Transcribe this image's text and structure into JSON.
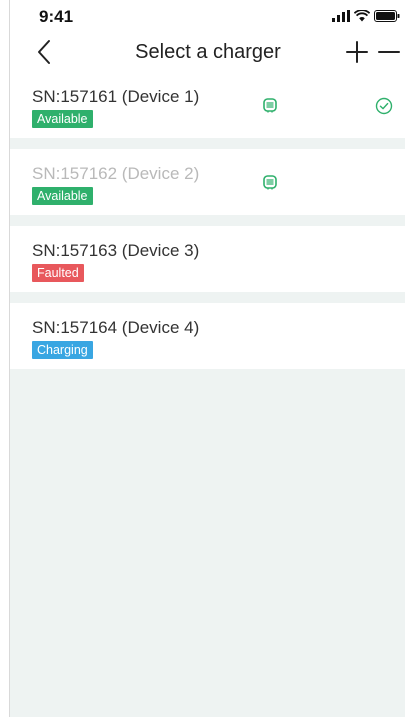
{
  "status_bar": {
    "time": "9:41"
  },
  "nav": {
    "title": "Select a charger"
  },
  "colors": {
    "available": "#2fb06c",
    "faulted": "#e8585c",
    "charging": "#39a6e2",
    "accent": "#2fb06c"
  },
  "chargers": [
    {
      "label": "SN:157161 (Device 1)",
      "status": "Available",
      "status_color": "#2fb06c",
      "icon": "charger-plug-icon",
      "selected": true
    },
    {
      "label": "SN:157162 (Device 2)",
      "status": "Available",
      "status_color": "#2fb06c",
      "icon": "charger-plug-icon",
      "disabled": true
    },
    {
      "label": "SN:157163 (Device 3)",
      "status": "Faulted",
      "status_color": "#e8585c"
    },
    {
      "label": "SN:157164 (Device 4)",
      "status": "Charging",
      "status_color": "#39a6e2"
    }
  ]
}
